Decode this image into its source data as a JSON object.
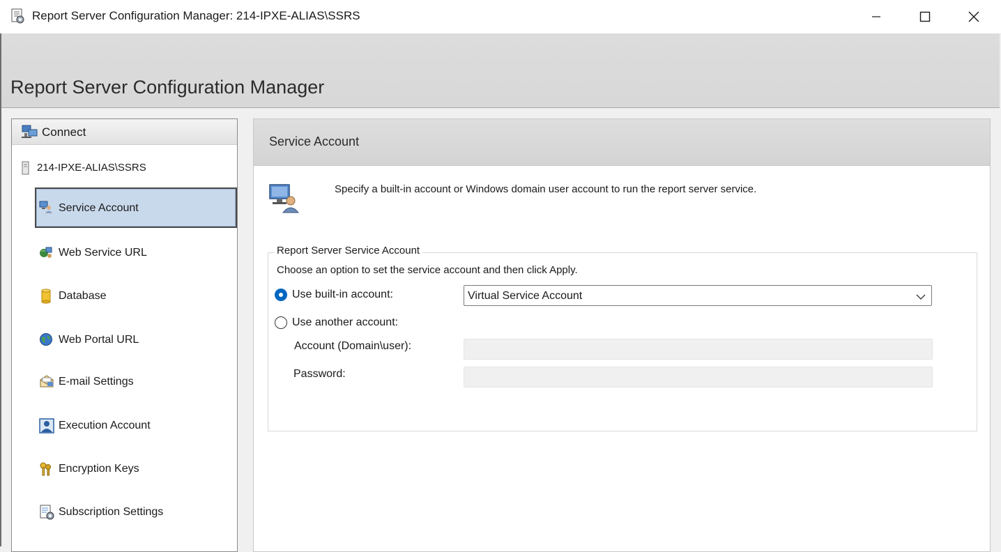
{
  "window": {
    "title": "Report Server Configuration Manager: 214-IPXE-ALIAS\\SSRS"
  },
  "banner": {
    "heading": "Report Server Configuration Manager"
  },
  "nav": {
    "connect_label": "Connect",
    "server_name": "214-IPXE-ALIAS\\SSRS",
    "items": [
      {
        "label": "Service Account",
        "icon": "service-account-icon",
        "selected": true
      },
      {
        "label": "Web Service URL",
        "icon": "web-service-url-icon"
      },
      {
        "label": "Database",
        "icon": "database-icon"
      },
      {
        "label": "Web Portal URL",
        "icon": "globe-icon"
      },
      {
        "label": "E-mail Settings",
        "icon": "email-icon"
      },
      {
        "label": "Execution Account",
        "icon": "execution-account-icon"
      },
      {
        "label": "Encryption Keys",
        "icon": "keys-icon"
      },
      {
        "label": "Subscription Settings",
        "icon": "subscription-icon"
      }
    ]
  },
  "content": {
    "header": "Service Account",
    "description": "Specify a built-in account or Windows domain user account to run the report server service.",
    "group": {
      "legend": "Report Server Service Account",
      "instructions": "Choose an option to set the service account and then click Apply.",
      "builtin_label": "Use built-in account:",
      "builtin_selected": true,
      "builtin_value": "Virtual Service Account",
      "another_label": "Use another account:",
      "account_label": "Account (Domain\\user):",
      "account_value": "",
      "password_label": "Password:",
      "password_value": ""
    }
  },
  "colors": {
    "selection": "#c9d9ec",
    "radio_accent": "#0067c0"
  }
}
